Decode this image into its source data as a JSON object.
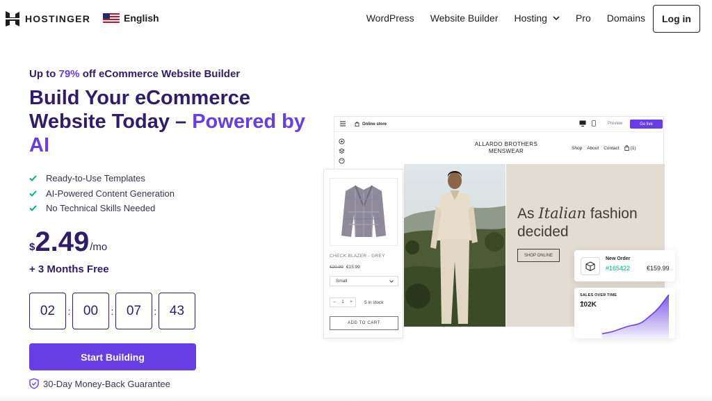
{
  "nav": {
    "brand": "HOSTINGER",
    "language": "English",
    "links": [
      "WordPress",
      "Website Builder",
      "Hosting",
      "Pro",
      "Domains"
    ],
    "login_label": "Log in"
  },
  "hero": {
    "promo_prefix": "Up to ",
    "promo_accent": "79%",
    "promo_suffix": " off eCommerce Website Builder",
    "headline_main": "Build Your eCommerce Website Today – ",
    "headline_accent": "Powered by AI",
    "features": [
      "Ready-to-Use Templates",
      "AI-Powered Content Generation",
      "No Technical Skills Needed"
    ],
    "price_currency": "$",
    "price_amount": "2.49",
    "price_period": "/mo",
    "bonus": "+ 3 Months Free",
    "timer": [
      "02",
      "00",
      "07",
      "43"
    ],
    "timer_separator": ":",
    "cta_label": "Start Building",
    "guarantee": "30-Day Money-Back Guarantee"
  },
  "mockup": {
    "store_label": "Online store",
    "preview_label": "Preview",
    "golive_label": "Go live",
    "brand_name": "ALLARDO BROTHERS MENSWEAR",
    "store_nav": [
      "Shop",
      "About",
      "Contact",
      "(1)"
    ],
    "tagline_prefix": "As ",
    "tagline_italic": "Italian",
    "tagline_suffix": " fashion decided",
    "shop_button": "SHOP ONLINE",
    "product": {
      "name": "CHECK BLAZER - GREY",
      "old_price": "€20.99",
      "new_price": "€15.99",
      "size": "Small",
      "qty_minus": "–",
      "qty": "1",
      "qty_plus": "+",
      "stock": "5 in stock",
      "add_label": "ADD TO CART"
    },
    "order": {
      "title": "New Order",
      "id": "#165422",
      "amount": "€159.99"
    },
    "sales": {
      "title": "SALES OVER TIME",
      "value": "102K",
      "trend_icon": "arrow-up-icon"
    }
  },
  "colors": {
    "accent": "#673de6",
    "navy": "#2f1c6a",
    "check": "#00b090",
    "beige": "#e3dcd3"
  }
}
